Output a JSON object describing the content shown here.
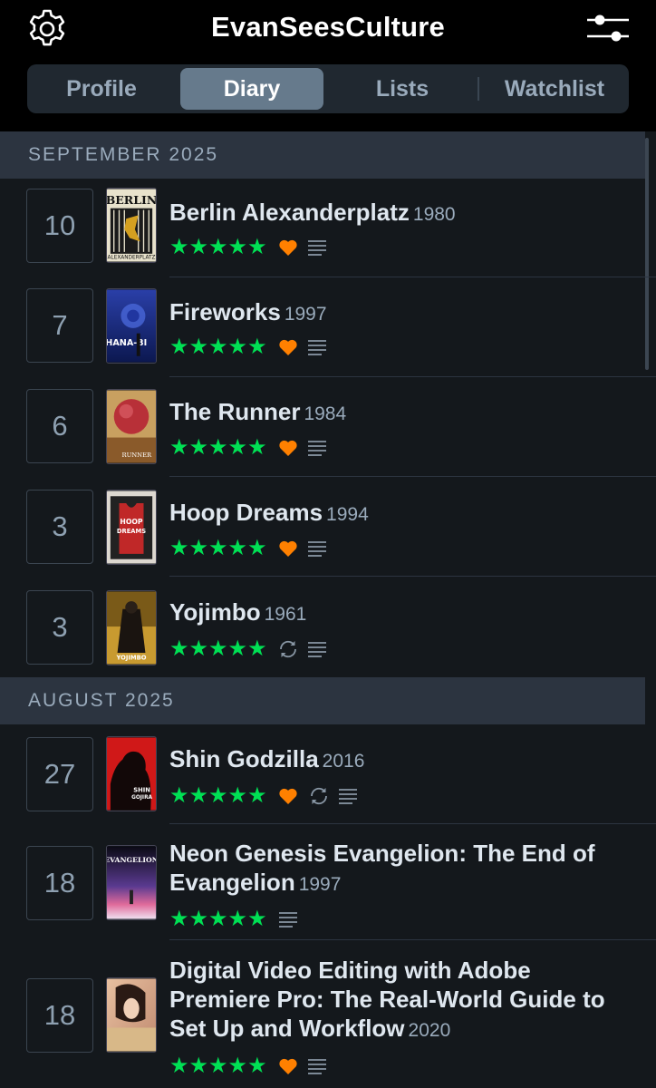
{
  "header": {
    "title": "EvanSeesCulture",
    "left_icon": "gear-icon",
    "right_icon": "filter-sliders-icon"
  },
  "tabs": [
    {
      "label": "Profile",
      "active": false
    },
    {
      "label": "Diary",
      "active": true
    },
    {
      "label": "Lists",
      "active": false
    },
    {
      "label": "Watchlist",
      "active": false
    }
  ],
  "colors": {
    "accent_green": "#00e054",
    "heart_orange": "#ff8000",
    "background": "#14181c",
    "month_bar": "#2c3440"
  },
  "months": [
    {
      "label": "SEPTEMBER 2025",
      "entries": [
        {
          "day": "10",
          "title": "Berlin Alexanderplatz",
          "year": "1980",
          "stars": "★★★★★",
          "liked": true,
          "rewatch": false,
          "review": true
        },
        {
          "day": "7",
          "title": "Fireworks",
          "year": "1997",
          "stars": "★★★★★",
          "liked": true,
          "rewatch": false,
          "review": true
        },
        {
          "day": "6",
          "title": "The Runner",
          "year": "1984",
          "stars": "★★★★★",
          "liked": true,
          "rewatch": false,
          "review": true
        },
        {
          "day": "3",
          "title": "Hoop Dreams",
          "year": "1994",
          "stars": "★★★★★",
          "liked": true,
          "rewatch": false,
          "review": true
        },
        {
          "day": "3",
          "title": "Yojimbo",
          "year": "1961",
          "stars": "★★★★★",
          "liked": false,
          "rewatch": true,
          "review": true
        }
      ]
    },
    {
      "label": "AUGUST 2025",
      "entries": [
        {
          "day": "27",
          "title": "Shin Godzilla",
          "year": "2016",
          "stars": "★★★★★",
          "liked": true,
          "rewatch": true,
          "review": true
        },
        {
          "day": "18",
          "title": "Neon Genesis Evangelion: The End of Evangelion",
          "year": "1997",
          "stars": "★★★★★",
          "liked": false,
          "rewatch": false,
          "review": true
        },
        {
          "day": "18",
          "title": "Digital Video Editing with Adobe Premiere Pro: The Real-World Guide to Set Up and Workflow",
          "year": "2020",
          "stars": "★★★★★",
          "liked": true,
          "rewatch": false,
          "review": true
        }
      ]
    }
  ]
}
